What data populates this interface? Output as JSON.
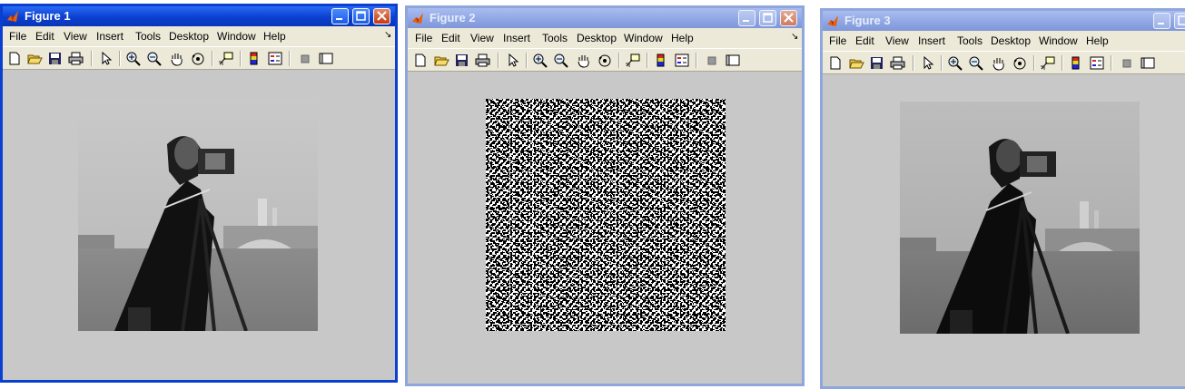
{
  "figure1": {
    "title": "Figure 1",
    "menus": [
      "File",
      "Edit",
      "View",
      "Insert",
      "Tools",
      "Desktop",
      "Window",
      "Help"
    ],
    "image_kind": "cameraman"
  },
  "figure2": {
    "title": "Figure 2",
    "menus": [
      "File",
      "Edit",
      "View",
      "Insert",
      "Tools",
      "Desktop",
      "Window",
      "Help"
    ],
    "image_kind": "encrypted noise"
  },
  "figure3": {
    "title": "Figure 3",
    "menus": [
      "File",
      "Edit",
      "View",
      "Insert",
      "Tools",
      "Desktop",
      "Window",
      "Help"
    ],
    "image_kind": "cameraman"
  },
  "toolbar_icons": [
    "new-figure-icon",
    "open-file-icon",
    "save-icon",
    "print-icon",
    "edit-plot-arrow-icon",
    "zoom-in-icon",
    "zoom-out-icon",
    "pan-hand-icon",
    "rotate-3d-icon",
    "data-cursor-icon",
    "insert-colorbar-icon",
    "insert-legend-icon",
    "hide-plot-tools-icon",
    "show-plot-tools-icon"
  ],
  "colors": {
    "active_title": "#0a3fd0",
    "inactive_title": "#8fa6dc",
    "figure_bg": "#c8c8c8",
    "menubar_bg": "#ece9d8"
  }
}
